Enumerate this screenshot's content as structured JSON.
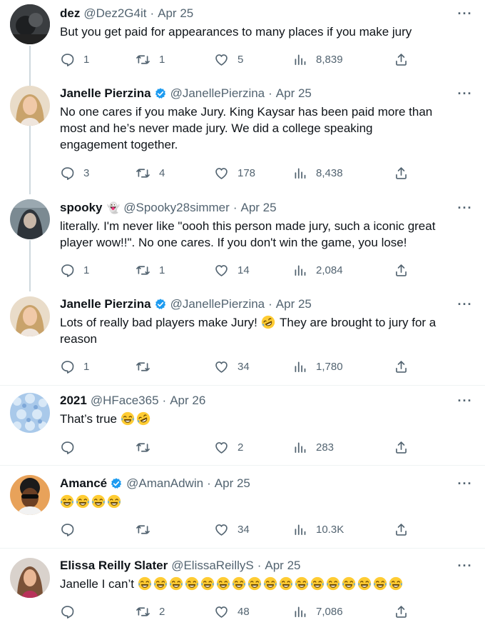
{
  "icons": {
    "reply": "reply-icon",
    "retweet": "retweet-icon",
    "like": "heart-icon",
    "views": "views-icon",
    "share": "share-icon",
    "more": "more-icon",
    "verified": "verified-badge-icon"
  },
  "colors": {
    "text": "#0f1419",
    "muted": "#536471",
    "verified": "#1d9bf0",
    "thread_line": "#cfd9de"
  },
  "tweets": [
    {
      "name": "dez",
      "handle": "@Dez2G4it",
      "sep": "·",
      "date": "Apr 25",
      "verified": false,
      "text": "But you get paid for appearances to many places if you make jury",
      "replies": "1",
      "retweets": "1",
      "likes": "5",
      "views": "8,839"
    },
    {
      "name": "Janelle Pierzina",
      "handle": "@JanellePierzina",
      "sep": "·",
      "date": "Apr 25",
      "verified": true,
      "text": "No one cares if you make Jury. King Kaysar has been paid more than most and he’s never made jury. We did a college speaking engagement together.",
      "replies": "3",
      "retweets": "4",
      "likes": "178",
      "views": "8,438"
    },
    {
      "name": "spooky",
      "name_emoji": "👻",
      "handle": "@Spooky28simmer",
      "sep": "·",
      "date": "Apr 25",
      "verified": false,
      "text": "literally. I'm never like \"oooh this person made jury, such a iconic great player wow!!\". No one cares. If you don't win the game, you lose!",
      "replies": "1",
      "retweets": "1",
      "likes": "14",
      "views": "2,084"
    },
    {
      "name": "Janelle Pierzina",
      "handle": "@JanellePierzina",
      "sep": "·",
      "date": "Apr 25",
      "verified": true,
      "text_a": "Lots of really bad players make Jury!",
      "text_b": "They are brought to jury for a reason",
      "replies": "1",
      "retweets": "",
      "likes": "34",
      "views": "1,780"
    },
    {
      "name": "2021",
      "handle": "@HFace365",
      "sep": "·",
      "date": "Apr 26",
      "verified": false,
      "text": "That’s true",
      "replies": "",
      "retweets": "",
      "likes": "2",
      "views": "283"
    },
    {
      "name": "Amancé",
      "handle": "@AmanAdwin",
      "sep": "·",
      "date": "Apr 25",
      "verified": true,
      "text": "",
      "replies": "",
      "retweets": "",
      "likes": "34",
      "views": "10.3K"
    },
    {
      "name": "Elissa Reilly Slater",
      "handle": "@ElissaReillyS",
      "sep": "·",
      "date": "Apr 25",
      "verified": false,
      "text": "Janelle I can’t",
      "replies": "",
      "retweets": "2",
      "likes": "48",
      "views": "7,086"
    }
  ]
}
